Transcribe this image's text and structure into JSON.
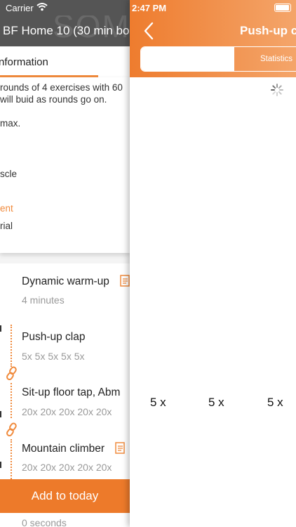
{
  "background_screen": {
    "status": {
      "carrier": "Carrier"
    },
    "watermark": "SOM",
    "title": "BF Home 10 (30 min bo",
    "tab_label": "nformation",
    "info": {
      "line1": "rounds of 4 exercises with 60",
      "line2": "will buid as rounds go on.",
      "line3": "max.",
      "line4": "scle",
      "equipment_label": "ent",
      "equipment_value": "rial"
    },
    "exercises": [
      {
        "name": "Dynamic warm-up",
        "detail": "4 minutes"
      },
      {
        "name": "Push-up clap",
        "detail": "5x 5x 5x 5x 5x"
      },
      {
        "name": "Sit-up floor tap, Abm",
        "detail": "20x 20x 20x 20x 20x"
      },
      {
        "name": "Mountain climber",
        "detail": "20x 20x 20x 20x 20x"
      },
      {
        "detail": "0 seconds"
      }
    ],
    "add_button": "Add to today"
  },
  "foreground_screen": {
    "status": {
      "time": "2:47 PM"
    },
    "nav_title": "Push-up c",
    "segments": {
      "first": "",
      "second": "Statistics"
    },
    "reps": [
      "5 x",
      "5 x",
      "5 x"
    ]
  },
  "colors": {
    "accent": "#ed7a2a",
    "gradient_end": "#f4a56a",
    "dark_header": "#555555"
  }
}
